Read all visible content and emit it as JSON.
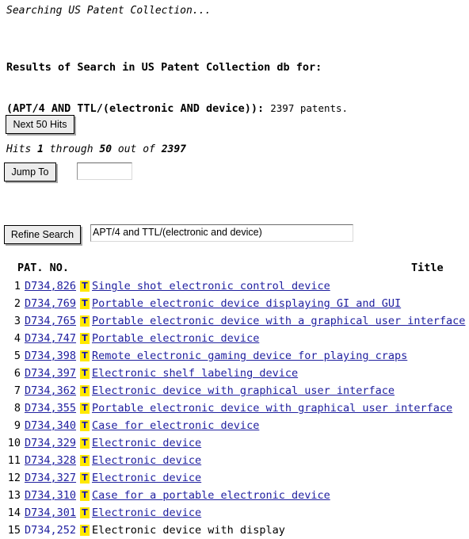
{
  "status": {
    "searching_text": "Searching US Patent Collection..."
  },
  "results_header": {
    "line1": "Results of Search in US Patent Collection db for:",
    "query": "(APT/4 AND TTL/(electronic AND device)): ",
    "count_text": "2397 patents.",
    "hits_prefix": "Hits ",
    "hits_from": "1",
    "hits_mid": " through ",
    "hits_to": "50",
    "hits_suffix": " out of ",
    "hits_total": "2397"
  },
  "controls": {
    "next_hits_label": "Next 50 Hits",
    "jump_to_label": "Jump To",
    "jump_to_value": "",
    "jump_to_placeholder": "",
    "refine_search_label": "Refine Search",
    "refine_search_value": "APT/4 and TTL/(electronic and device)"
  },
  "table": {
    "col_patno": "PAT. NO.",
    "col_title": "Title",
    "icon_name": "full-text-icon",
    "icon_glyph": "T",
    "rows": [
      {
        "num": "1",
        "patno": "D734,826",
        "title": "Single shot electronic control device"
      },
      {
        "num": "2",
        "patno": "D734,769",
        "title": "Portable electronic device displaying GI and GUI"
      },
      {
        "num": "3",
        "patno": "D734,765",
        "title": "Portable electronic device with a graphical user interface"
      },
      {
        "num": "4",
        "patno": "D734,747",
        "title": "Portable electronic device"
      },
      {
        "num": "5",
        "patno": "D734,398",
        "title": "Remote electronic gaming device for playing craps"
      },
      {
        "num": "6",
        "patno": "D734,397",
        "title": "Electronic shelf labeling device"
      },
      {
        "num": "7",
        "patno": "D734,362",
        "title": "Electronic device with graphical user interface"
      },
      {
        "num": "8",
        "patno": "D734,355",
        "title": "Portable electronic device with graphical user interface"
      },
      {
        "num": "9",
        "patno": "D734,340",
        "title": "Case for electronic device"
      },
      {
        "num": "10",
        "patno": "D734,329",
        "title": "Electronic device"
      },
      {
        "num": "11",
        "patno": "D734,328",
        "title": "Electronic device"
      },
      {
        "num": "12",
        "patno": "D734,327",
        "title": "Electronic device"
      },
      {
        "num": "13",
        "patno": "D734,310",
        "title": "Case for a portable electronic device"
      },
      {
        "num": "14",
        "patno": "D734,301",
        "title": "Electronic device"
      },
      {
        "num": "15",
        "patno": "D734,252",
        "title": "Electronic device with display"
      }
    ]
  },
  "colors": {
    "link": "#2020a0",
    "icon_bg": "#ffe800",
    "icon_fg": "#1414b4",
    "button_face": "#ececec",
    "page_bg": "#ffffff"
  }
}
